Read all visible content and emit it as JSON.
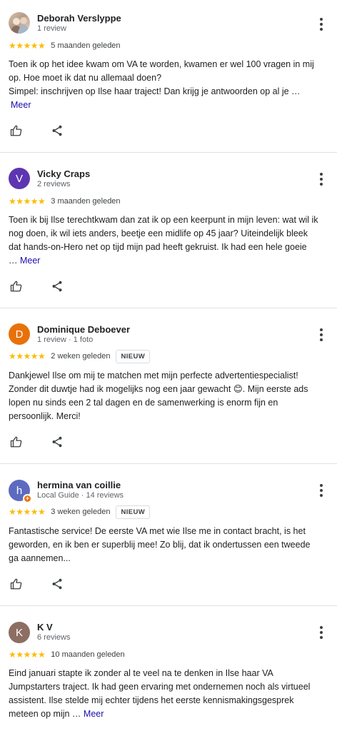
{
  "colors": {
    "star": "#fbbc04",
    "link": "#1a0dab",
    "avatar_vicky": "#5e35b1",
    "avatar_dominique": "#e8710a",
    "avatar_hermina": "#5c6bc0",
    "avatar_kv": "#8d6e63"
  },
  "icons": {
    "like": "thumbs-up-icon",
    "share": "share-icon",
    "menu": "more-vert-icon"
  },
  "reviews": [
    {
      "name": "Deborah Verslyppe",
      "meta": "1 review",
      "stars": "★★★★★",
      "date": "5 maanden geleden",
      "lines": [
        "Toen ik op het idee kwam om VA te worden, kwamen er wel 100 vragen in mij",
        "op. Hoe moet ik dat nu allemaal doen?",
        "Simpel: inschrijven op Ilse haar traject! Dan krijg je antwoorden op al je …"
      ],
      "more": "Meer"
    },
    {
      "name": "Vicky Craps",
      "initial": "V",
      "meta": "2 reviews",
      "stars": "★★★★★",
      "date": "3 maanden geleden",
      "lines": [
        "Toen ik bij Ilse terechtkwam dan zat ik op een keerpunt in mijn leven: wat wil ik",
        "nog doen, ik wil iets anders, beetje een midlife op 45 jaar? Uiteindelijk bleek",
        "dat hands-on-Hero net op tijd mijn pad heeft gekruist. Ik had een hele goeie",
        "… "
      ],
      "more": "Meer"
    },
    {
      "name": "Dominique Deboever",
      "initial": "D",
      "meta": "1 review · 1 foto",
      "stars": "★★★★★",
      "date": "2 weken geleden",
      "badge": "NIEUW",
      "lines": [
        "Dankjewel Ilse om mij te matchen met mijn perfecte advertentiespecialist!",
        "Zonder dit duwtje had ik mogelijks nog een jaar gewacht 😊. Mijn eerste ads",
        "lopen nu sinds een 2 tal dagen en de samenwerking is enorm fijn en",
        "persoonlijk. Merci!"
      ]
    },
    {
      "name": "hermina van coillie",
      "initial": "h",
      "meta": "Local Guide · 14 reviews",
      "stars": "★★★★★",
      "date": "3 weken geleden",
      "badge": "NIEUW",
      "lines": [
        "Fantastische service! De eerste VA met wie Ilse me in contact bracht, is het",
        "geworden, en ik ben er superblij mee! Zo blij, dat ik ondertussen een tweede",
        "ga aannemen..."
      ]
    },
    {
      "name": "K V",
      "initial": "K",
      "meta": "6 reviews",
      "stars": "★★★★★",
      "date": "10 maanden geleden",
      "lines": [
        "Eind januari stapte ik zonder al te veel na te denken in Ilse haar VA",
        "Jumpstarters traject. Ik had geen ervaring met ondernemen noch als virtueel",
        "assistent. Ilse stelde mij echter tijdens het eerste kennismakingsgesprek",
        "meteen op mijn … "
      ],
      "more": "Meer"
    }
  ]
}
